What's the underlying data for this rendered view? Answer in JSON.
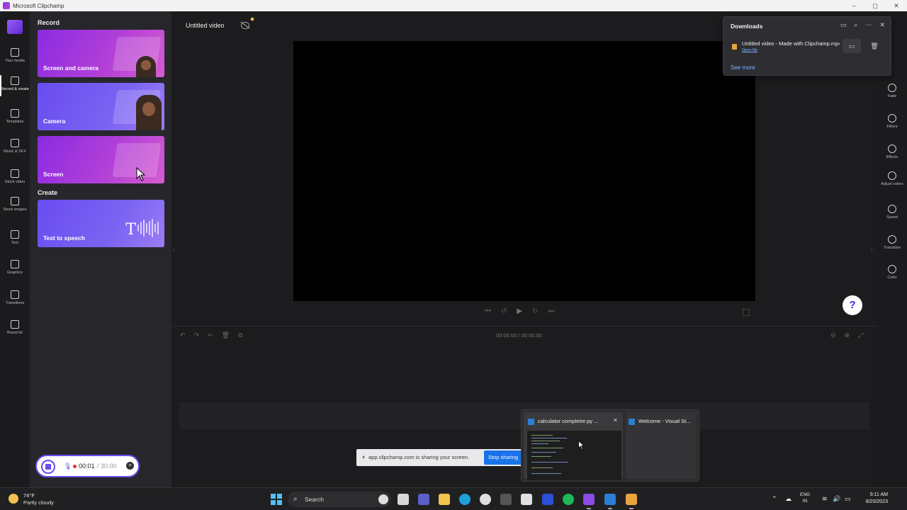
{
  "window": {
    "title": "Microsoft Clipchamp",
    "controls": [
      "–",
      "◻",
      "✕"
    ]
  },
  "left_nav": {
    "items": [
      {
        "label": "Your media",
        "icon": "folder-icon"
      },
      {
        "label": "Record & create",
        "icon": "video-camera-icon",
        "active": true
      },
      {
        "label": "Templates",
        "icon": "templates-icon"
      },
      {
        "label": "Music & SFX",
        "icon": "music-note-icon"
      },
      {
        "label": "Stock video",
        "icon": "film-icon"
      },
      {
        "label": "Stock images",
        "icon": "image-icon"
      },
      {
        "label": "Text",
        "icon": "text-icon"
      },
      {
        "label": "Graphics",
        "icon": "shapes-icon"
      },
      {
        "label": "Transitions",
        "icon": "transition-icon"
      },
      {
        "label": "Brand kit",
        "icon": "brand-kit-icon"
      }
    ]
  },
  "panel": {
    "record_title": "Record",
    "create_title": "Create",
    "cards": {
      "screen_and_camera": "Screen and camera",
      "camera": "Camera",
      "screen": "Screen",
      "text_to_speech": "Text to speech",
      "tts_glyph": "T"
    }
  },
  "editor": {
    "project_title": "Untitled video",
    "timecode": "00:00.00 / 00:00.00",
    "help_label": "?"
  },
  "right_bar": {
    "items": [
      {
        "label": "Fade",
        "icon": "fade-icon"
      },
      {
        "label": "Filters",
        "icon": "filters-icon"
      },
      {
        "label": "Effects",
        "icon": "effects-wand-icon"
      },
      {
        "label": "Adjust colors",
        "icon": "adjust-colors-icon"
      },
      {
        "label": "Speed",
        "icon": "speed-gauge-icon"
      },
      {
        "label": "Transition",
        "icon": "transition-icon"
      },
      {
        "label": "Color",
        "icon": "color-palette-icon"
      }
    ]
  },
  "downloads": {
    "title": "Downloads",
    "file_name": "Untitled video - Made with Clipchamp.mp4",
    "open_file": "Open file",
    "see_more": "See more"
  },
  "recording": {
    "elapsed": "00:01",
    "max": "/ 30:00",
    "close": "×"
  },
  "share_bar": {
    "message": "app.clipchamp.com is sharing your screen.",
    "stop_label": "Stop sharing"
  },
  "taskbar_preview": {
    "window1_title": "calculator completre.py ...",
    "window2_title": "Welcome - Visual St..."
  },
  "taskbar": {
    "weather_temp": "74°F",
    "weather_desc": "Partly cloudy",
    "search_label": "Search",
    "lang_line1": "ENG",
    "lang_line2": "IN",
    "time": "6:11 AM",
    "date": "8/20/2023"
  },
  "colors": {
    "accent": "#6a4cf0",
    "record_red": "#e0302e",
    "share_blue": "#1a73e8",
    "link_blue": "#7db3ff"
  }
}
